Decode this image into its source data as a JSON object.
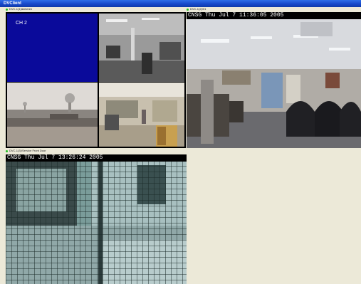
{
  "window": {
    "title": "DVClient"
  },
  "cameras": {
    "cam1": {
      "label": "DVC-1(1)&kitchen",
      "channel_text": "CH 2"
    },
    "cam2": {
      "label": "DVC-1(2)/01",
      "osd": "CNSG  Thu Jul  7  11:36:05  2005"
    },
    "cam3": {
      "label": "DVC-1(3)/Service Front Door",
      "osd": "CNSG  Thu Jul  7  13:26:24  2005"
    }
  },
  "colors": {
    "titlebar": "#1546c8",
    "channel_blue": "#0a0a9a",
    "panel_bg": "#ece9d8",
    "live_dot": "#22c022"
  }
}
